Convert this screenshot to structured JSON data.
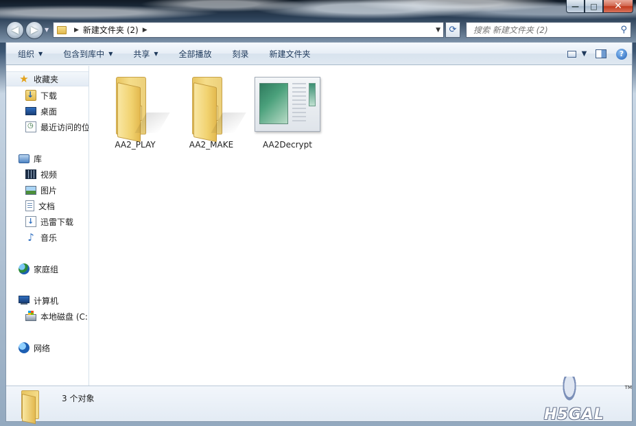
{
  "window": {
    "controls": {
      "minimize": "—",
      "maximize": "□",
      "close": "✕"
    }
  },
  "address_bar": {
    "path": [
      "新建文件夹 (2)"
    ],
    "search_placeholder": "搜索 新建文件夹 (2)"
  },
  "toolbar": {
    "organize": "组织",
    "include_in_library": "包含到库中",
    "share": "共享",
    "play_all": "全部播放",
    "burn": "刻录",
    "new_folder": "新建文件夹"
  },
  "nav": {
    "favorites": {
      "label": "收藏夹",
      "items": [
        {
          "label": "下载",
          "icon": "download-folder-icon"
        },
        {
          "label": "桌面",
          "icon": "desktop-icon"
        },
        {
          "label": "最近访问的位",
          "icon": "recent-places-icon"
        }
      ]
    },
    "libraries": {
      "label": "库",
      "items": [
        {
          "label": "视频",
          "icon": "video-library-icon"
        },
        {
          "label": "图片",
          "icon": "picture-library-icon"
        },
        {
          "label": "文档",
          "icon": "document-library-icon"
        },
        {
          "label": "迅雷下载",
          "icon": "xunlei-download-icon"
        },
        {
          "label": "音乐",
          "icon": "music-library-icon"
        }
      ]
    },
    "homegroup": {
      "label": "家庭组"
    },
    "computer": {
      "label": "计算机",
      "items": [
        {
          "label": "本地磁盘 (C:)",
          "icon": "local-disk-icon"
        }
      ]
    },
    "network": {
      "label": "网络"
    }
  },
  "files": [
    {
      "name": "AA2_PLAY",
      "type": "folder"
    },
    {
      "name": "AA2_MAKE",
      "type": "folder"
    },
    {
      "name": "AA2Decrypt",
      "type": "application"
    }
  ],
  "details": {
    "count_text": "3 个对象"
  },
  "watermark": {
    "text": "H5GAL",
    "tm": "TM"
  },
  "colors": {
    "toolbar_text": "#1e395b",
    "folder_yellow": "#f1d270",
    "accent_blue": "#2f6fc0"
  }
}
